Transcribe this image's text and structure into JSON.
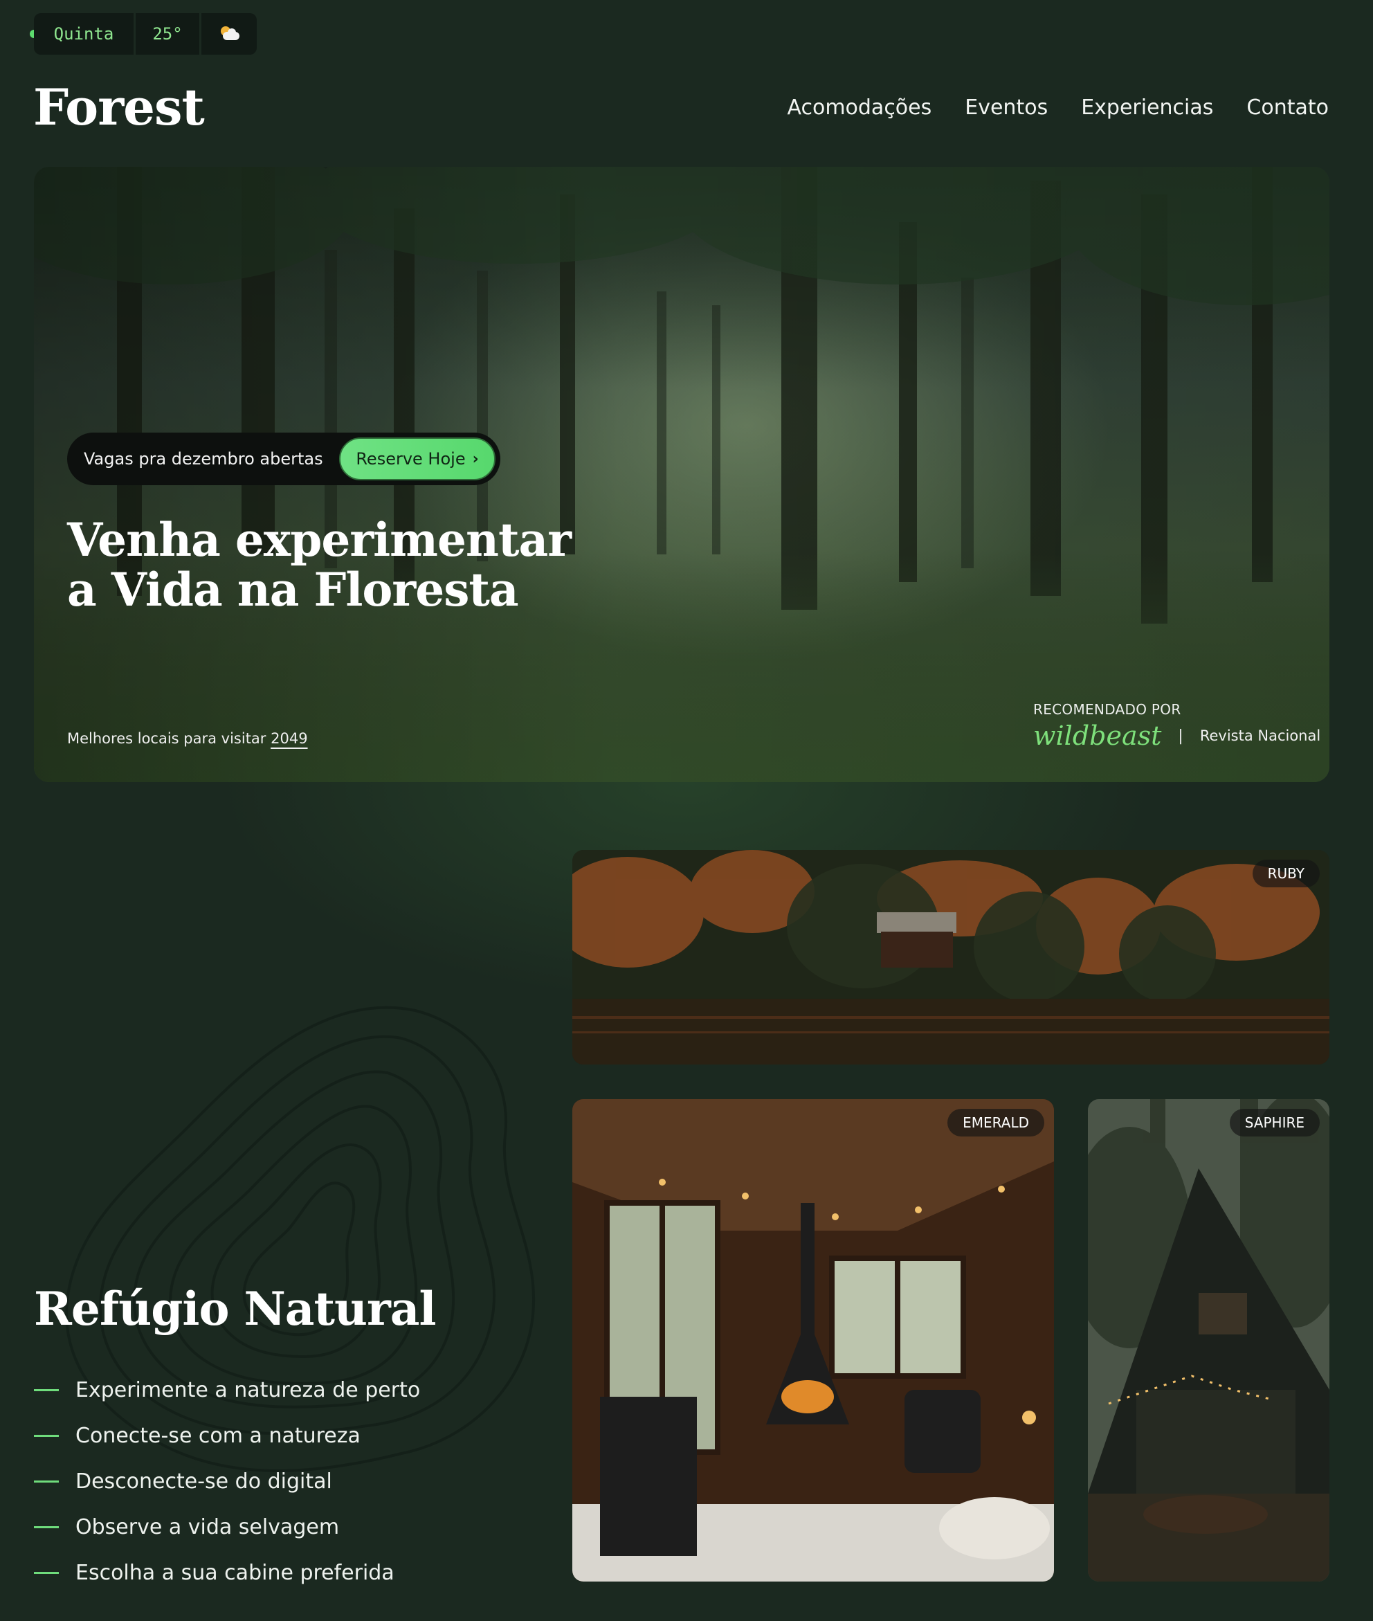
{
  "status": {
    "day": "Quinta",
    "temperature": "25°",
    "weather_icon": "partly-cloudy-icon"
  },
  "header": {
    "logo": "Forest",
    "nav": [
      "Acomodações",
      "Eventos",
      "Experiencias",
      "Contato"
    ]
  },
  "hero": {
    "cta_text": "Vagas pra dezembro abertas",
    "cta_button": "Reserve Hoje",
    "title_line1": "Venha experimentar",
    "title_line2": "a Vida na Floresta",
    "footer_text": "Melhores locais para visitar",
    "footer_year": "2049",
    "recommended_label": "RECOMENDADO POR",
    "recommended_brand": "wildbeast",
    "recommended_separator": "|",
    "recommended_magazine": "Revista Nacional"
  },
  "section": {
    "title": "Refúgio Natural",
    "features": [
      "Experimente a natureza de perto",
      "Conecte-se com a natureza",
      "Desconecte-se do digital",
      "Observe a vida selvagem",
      "Escolha a sua cabine preferida"
    ]
  },
  "cabins": {
    "ruby": "RUBY",
    "emerald": "EMERALD",
    "saphire": "SAPHIRE"
  },
  "colors": {
    "background": "#1b2920",
    "accent": "#6fdc7c",
    "pill_dark": "#0d100e"
  }
}
